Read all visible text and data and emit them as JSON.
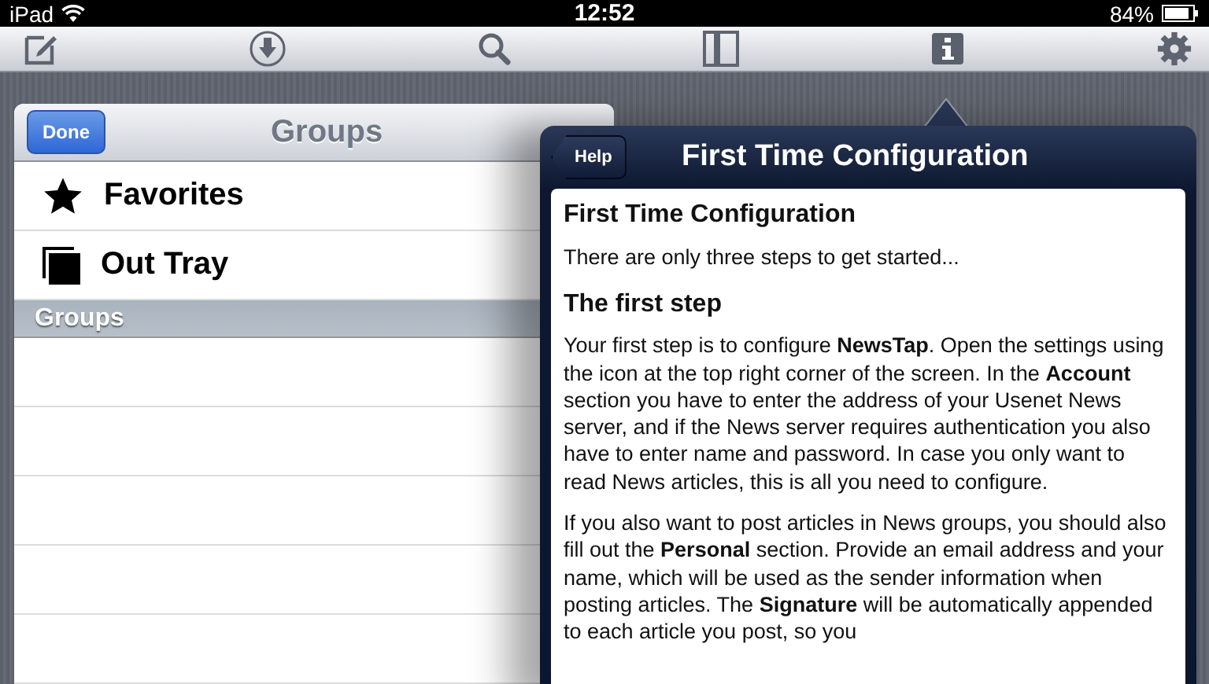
{
  "status_bar": {
    "device": "iPad",
    "time": "12:52",
    "battery": "84%"
  },
  "groups_panel": {
    "done_button": "Done",
    "title": "Groups",
    "items": [
      {
        "label": "Favorites",
        "kind": "star"
      },
      {
        "label": "Out Tray",
        "kind": "tray"
      }
    ],
    "section_header": "Groups"
  },
  "help_popover": {
    "back_button": "Help",
    "title": "First Time Configuration",
    "heading": "First Time Configuration",
    "intro": "There are only three steps to get started...",
    "sections": [
      {
        "heading": "The first step",
        "paragraphs": [
          "Your first step is to configure **NewsTap**. Open the settings using the icon at the top right corner of the screen. In the **Account** section you have to enter the address of your Usenet News server, and if the News server requires authentication you also have to enter name and password. In case you only want to read News articles, this is all you need to configure.",
          "If you also want to post articles in News groups, you should also fill out the **Personal** section. Provide an email address and your name, which will be used as the sender information when posting articles. The **Signature** will be automatically appended to each article you post, so you"
        ]
      }
    ]
  }
}
